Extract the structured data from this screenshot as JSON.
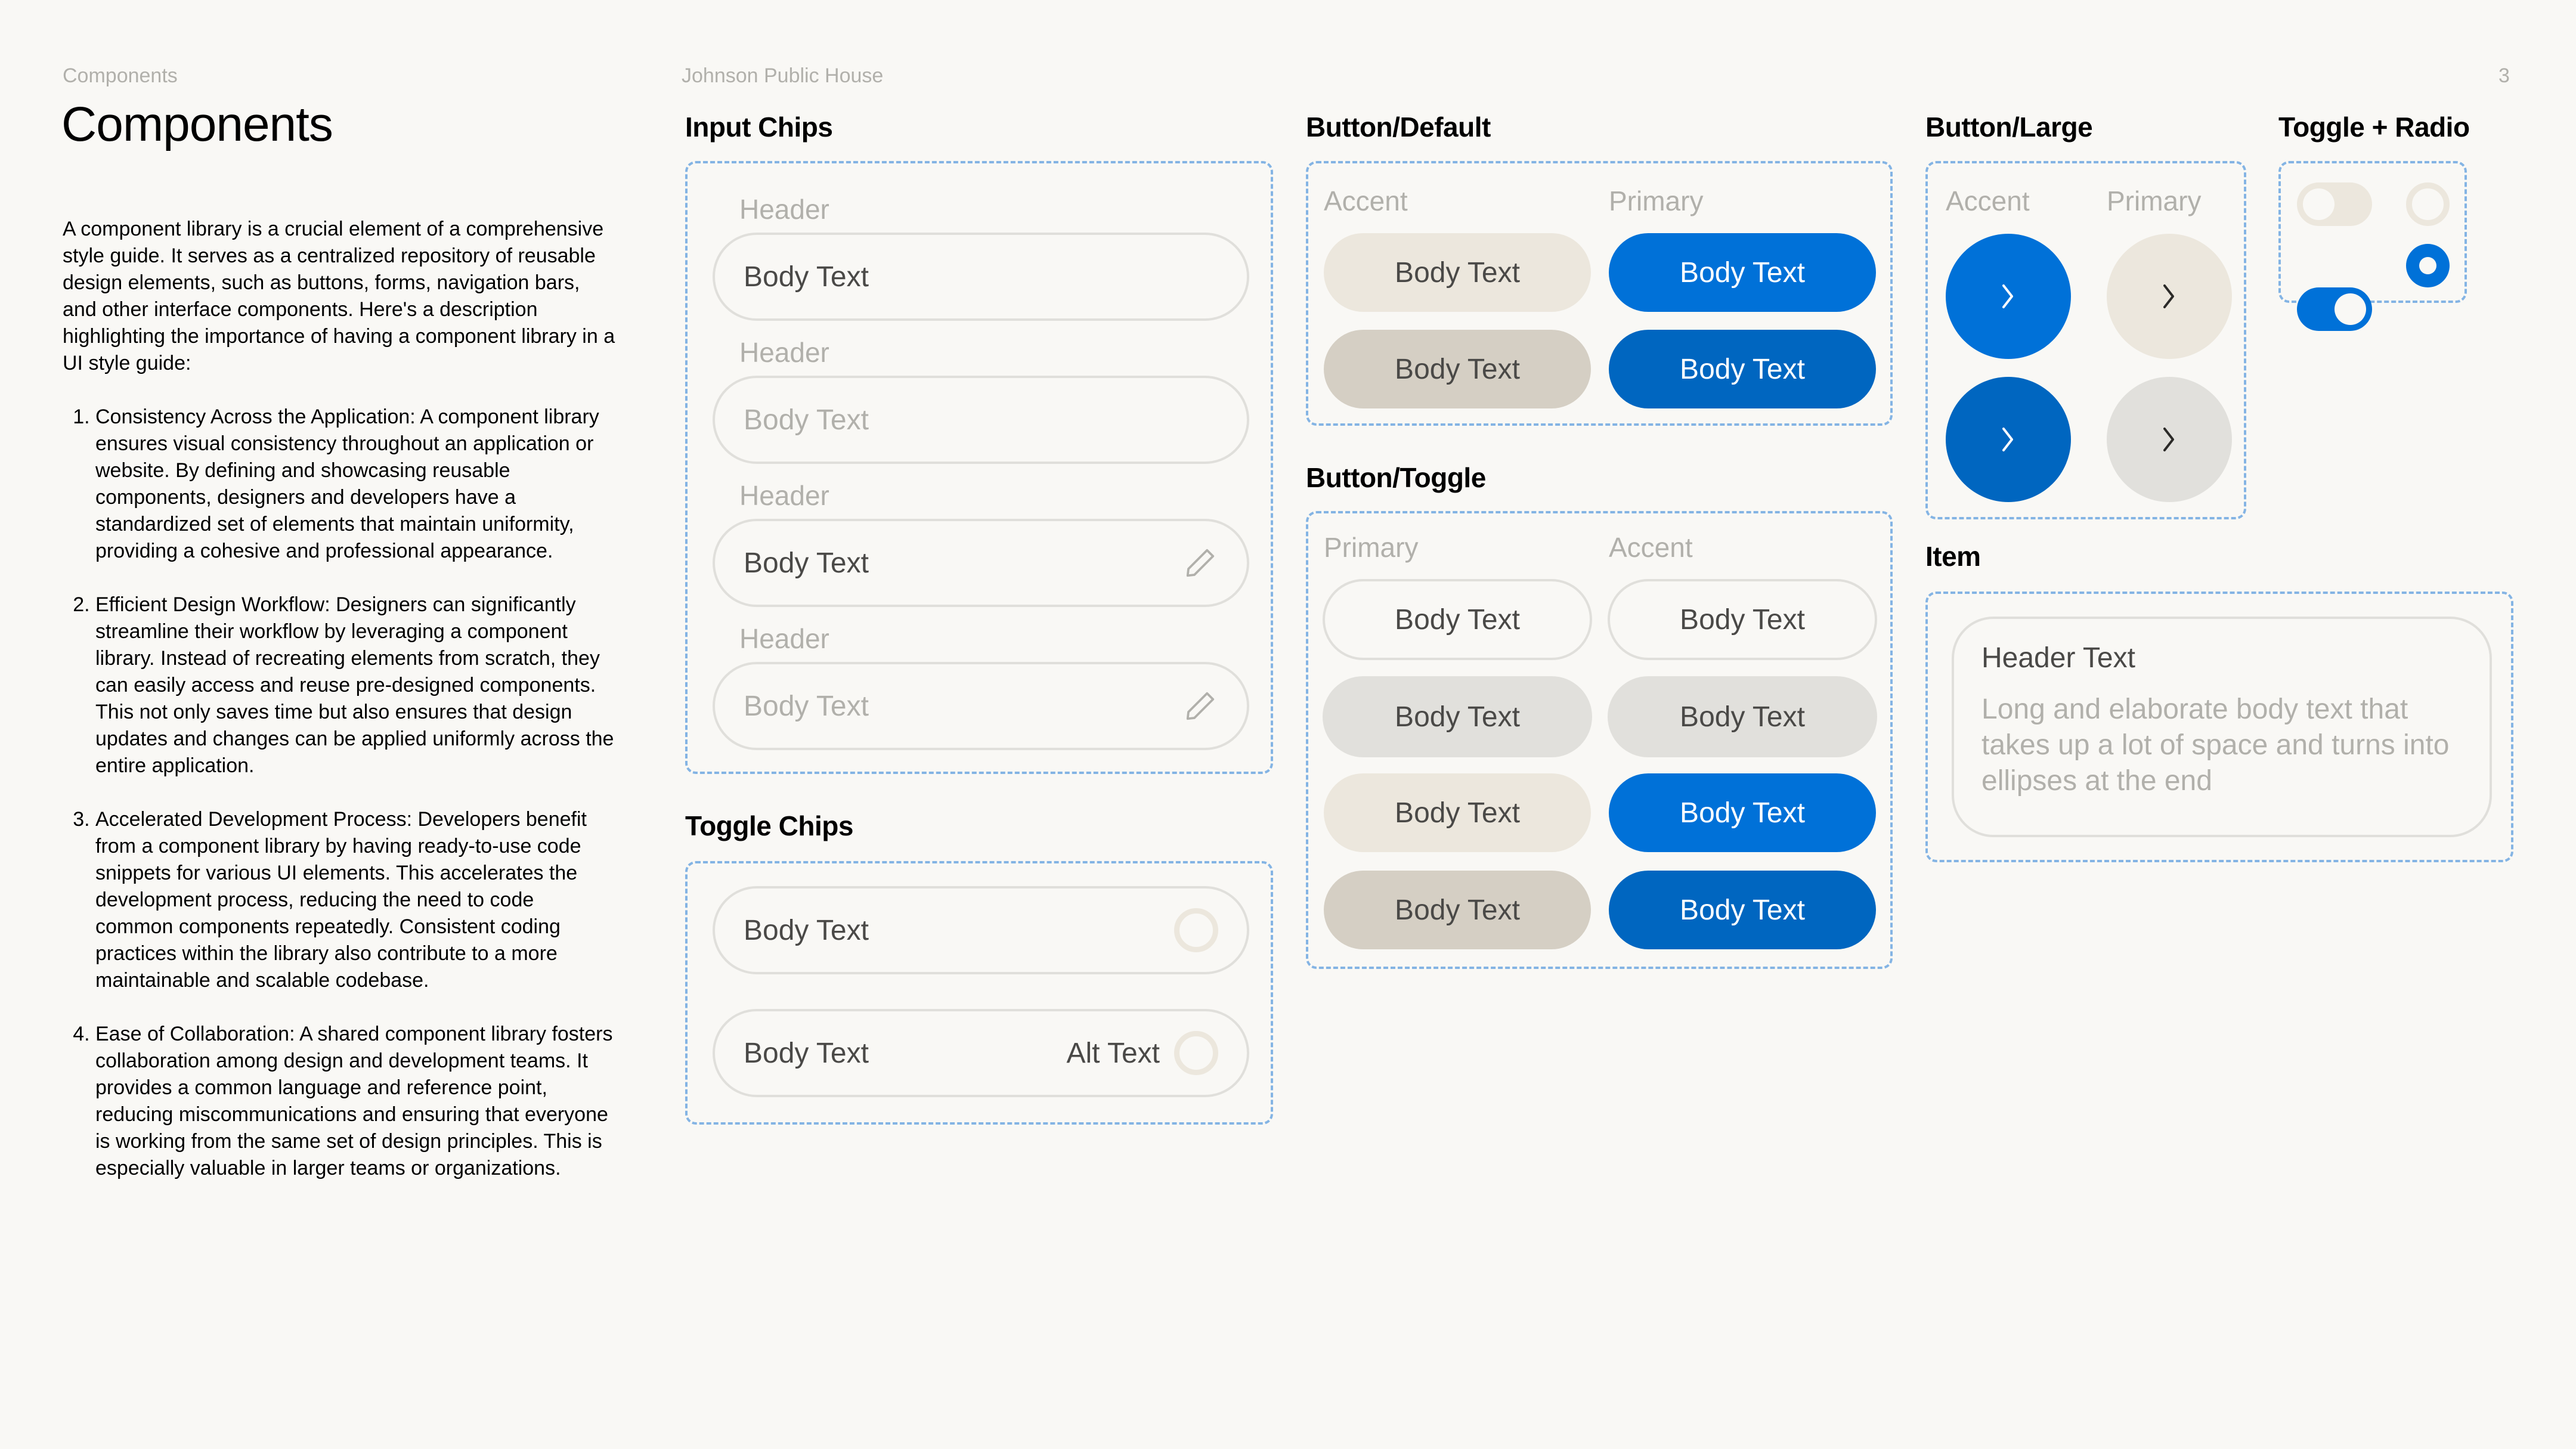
{
  "header": {
    "section_label": "Components",
    "project_name": "Johnson Public House",
    "page_number": "3"
  },
  "page_title": "Components",
  "intro": {
    "paragraph": "A component library is a crucial element of a comprehensive style guide. It serves as a centralized repository of reusable design elements, such as buttons, forms, navigation bars, and other interface components. Here's a description highlighting the importance of having a component library in a UI style guide:",
    "points": [
      "Consistency Across the Application: A component library ensures visual consistency throughout an application or website. By defining and showcasing reusable components, designers and developers have a standardized set of elements that maintain uniformity, providing a cohesive and professional appearance.",
      "Efficient Design Workflow: Designers can significantly streamline their workflow by leveraging a component library. Instead of recreating elements from scratch, they can easily access and reuse pre-designed components. This not only saves time but also ensures that design updates and changes can be applied uniformly across the entire application.",
      "Accelerated Development Process: Developers benefit from a component library by having ready-to-use code snippets for various UI elements. This accelerates the development process, reducing the need to code common components repeatedly. Consistent coding practices within the library also contribute to a more maintainable and scalable codebase.",
      "Ease of Collaboration: A shared component library fosters collaboration among design and development teams. It provides a common language and reference point, reducing miscommunications and ensuring that everyone is working from the same set of design principles. This is especially valuable in larger teams or organizations."
    ]
  },
  "colors": {
    "background": "#f9f8f5",
    "primary": "#0071d8",
    "primary_pressed": "#0066c0",
    "accent": "#ece7dd",
    "accent_pressed": "#d5cfc4",
    "neutral": "#e1e0dc",
    "guide_dash": "#84b4e4",
    "muted_text": "#b1b0ab",
    "body_text": "#4a4947"
  },
  "input_chips": {
    "title": "Input Chips",
    "items": [
      {
        "label": "Header",
        "value": "Body Text",
        "state": "filled",
        "icon": null
      },
      {
        "label": "Header",
        "value": "Body Text",
        "state": "placeholder",
        "icon": null
      },
      {
        "label": "Header",
        "value": "Body Text",
        "state": "filled",
        "icon": "pencil-icon"
      },
      {
        "label": "Header",
        "value": "Body Text",
        "state": "placeholder",
        "icon": "pencil-icon"
      }
    ]
  },
  "toggle_chips": {
    "title": "Toggle Chips",
    "items": [
      {
        "label": "Body Text",
        "alt": "",
        "checked": false
      },
      {
        "label": "Body Text",
        "alt": "Alt Text",
        "checked": false
      }
    ]
  },
  "button_default": {
    "title": "Button/Default",
    "columns": [
      "Accent",
      "Primary"
    ],
    "buttons": [
      [
        "Body Text",
        "Body Text"
      ],
      [
        "Body Text",
        "Body Text"
      ]
    ]
  },
  "button_toggle": {
    "title": "Button/Toggle",
    "columns": [
      "Primary",
      "Accent"
    ],
    "buttons": [
      [
        "Body Text",
        "Body Text"
      ],
      [
        "Body Text",
        "Body Text"
      ],
      [
        "Body Text",
        "Body Text"
      ],
      [
        "Body Text",
        "Body Text"
      ]
    ]
  },
  "button_large": {
    "title": "Button/Large",
    "columns": [
      "Accent",
      "Primary"
    ],
    "icon": "chevron-right-icon"
  },
  "toggle_radio": {
    "title": "Toggle + Radio",
    "toggles": [
      {
        "on": false
      },
      {
        "on": true
      }
    ],
    "radios": [
      {
        "selected": false
      },
      {
        "selected": true
      }
    ]
  },
  "item": {
    "title": "Item",
    "header": "Header Text",
    "body": "Long and elaborate body text that takes up a lot of space and turns into ellipses at the end"
  }
}
